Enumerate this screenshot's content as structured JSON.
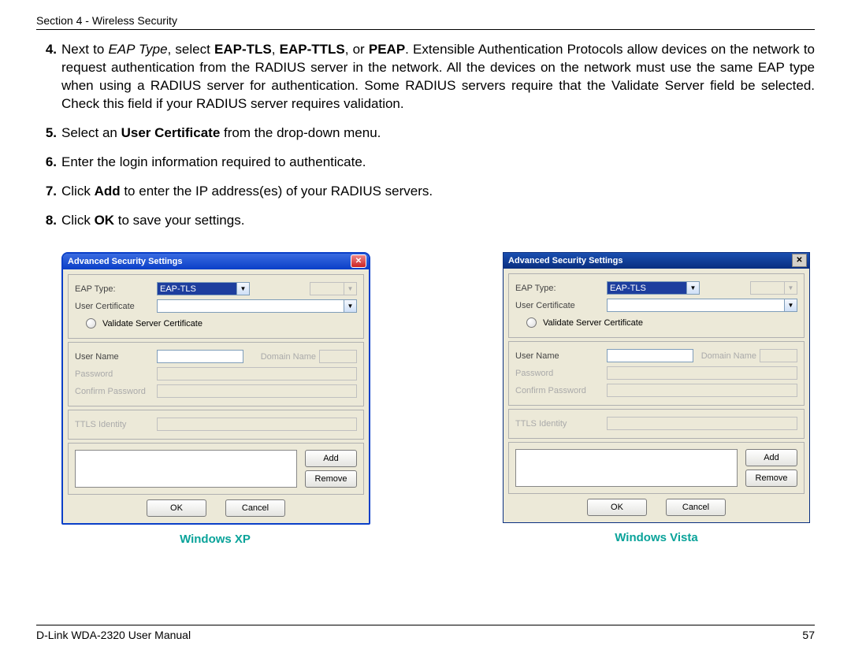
{
  "header": "Section 4 - Wireless Security",
  "steps": {
    "s4": {
      "num": "4.",
      "pre": "Next to ",
      "eaptype_it": "EAP Type",
      "mid1": ", select ",
      "opt1": "EAP-TLS",
      "comma1": ", ",
      "opt2": "EAP-TTLS",
      "comma2": ", or ",
      "opt3": "PEAP",
      "rest": ". Extensible Authentication Protocols allow devices on the network to request authentication from the RADIUS server in the network. All the devices on the network must use the same EAP type when using a RADIUS server for authentication. Some RADIUS servers require that the Validate Server field be selected. Check this field if your RADIUS server requires validation."
    },
    "s5": {
      "num": "5.",
      "pre": "Select an ",
      "bold": "User Certificate",
      "post": " from the drop-down menu."
    },
    "s6": {
      "num": "6.",
      "txt": "Enter the login information required to authenticate."
    },
    "s7": {
      "num": "7.",
      "pre": "Click ",
      "bold": "Add",
      "post": " to enter the IP address(es) of your RADIUS servers."
    },
    "s8": {
      "num": "8.",
      "pre": "Click ",
      "bold": "OK",
      "post": " to save your settings."
    }
  },
  "dialog": {
    "title": "Advanced Security Settings",
    "labels": {
      "eap_type": "EAP Type:",
      "user_cert": "User Certificate",
      "validate": "Validate Server Certificate",
      "user_name": "User Name",
      "password": "Password",
      "confirm": "Confirm Password",
      "ttls": "TTLS Identity",
      "domain": "Domain Name"
    },
    "eap_value": "EAP-TLS",
    "buttons": {
      "add": "Add",
      "remove": "Remove",
      "ok": "OK",
      "cancel": "Cancel"
    }
  },
  "captions": {
    "xp": "Windows XP",
    "vista": "Windows Vista"
  },
  "footer": {
    "left": "D-Link WDA-2320 User Manual",
    "right": "57"
  }
}
